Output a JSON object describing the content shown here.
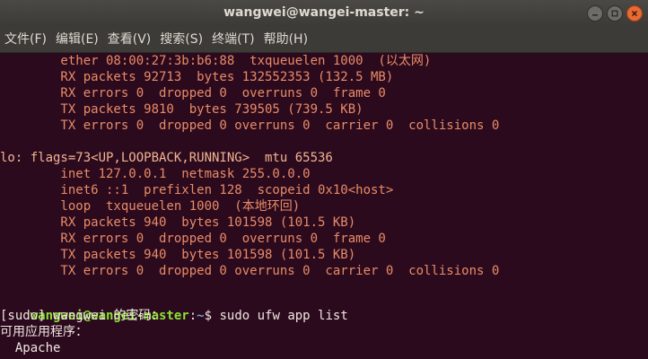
{
  "window": {
    "title": "wangwei@wangei-master: ~",
    "buttons": [
      "minimize-icon",
      "maximize-icon",
      "close-icon"
    ]
  },
  "menu": [
    "文件(F)",
    "编辑(E)",
    "查看(V)",
    "搜索(S)",
    "终端(T)",
    "帮助(H)"
  ],
  "lines": [
    "        ether 08:00:27:3b:b6:88  txqueuelen 1000  (以太网)",
    "        RX packets 92713  bytes 132552353 (132.5 MB)",
    "        RX errors 0  dropped 0  overruns 0  frame 0",
    "        TX packets 9810  bytes 739505 (739.5 KB)",
    "        TX errors 0  dropped 0 overruns 0  carrier 0  collisions 0",
    "",
    "lo: flags=73<UP,LOOPBACK,RUNNING>  mtu 65536",
    "        inet 127.0.0.1  netmask 255.0.0.0",
    "        inet6 ::1  prefixlen 128  scopeid 0x10<host>",
    "        loop  txqueuelen 1000  (本地环回)",
    "        RX packets 940  bytes 101598 (101.5 KB)",
    "        RX errors 0  dropped 0  overruns 0  frame 0",
    "        TX packets 940  bytes 101598 (101.5 KB)",
    "        TX errors 0  dropped 0 overruns 0  carrier 0  collisions 0",
    ""
  ],
  "prompt": {
    "user_host": "wangwei@wangei-master",
    "colon": ":",
    "path": "~",
    "symbol": "$ ",
    "command": "sudo ufw app list"
  },
  "output": [
    "[sudo] wangwei 的密码：",
    "可用应用程序：",
    "  Apache"
  ],
  "colors": {
    "background": "#2c0a1e",
    "text": "#e88b66",
    "prompt_user": "#8ae234",
    "prompt_path": "#729fcf"
  }
}
